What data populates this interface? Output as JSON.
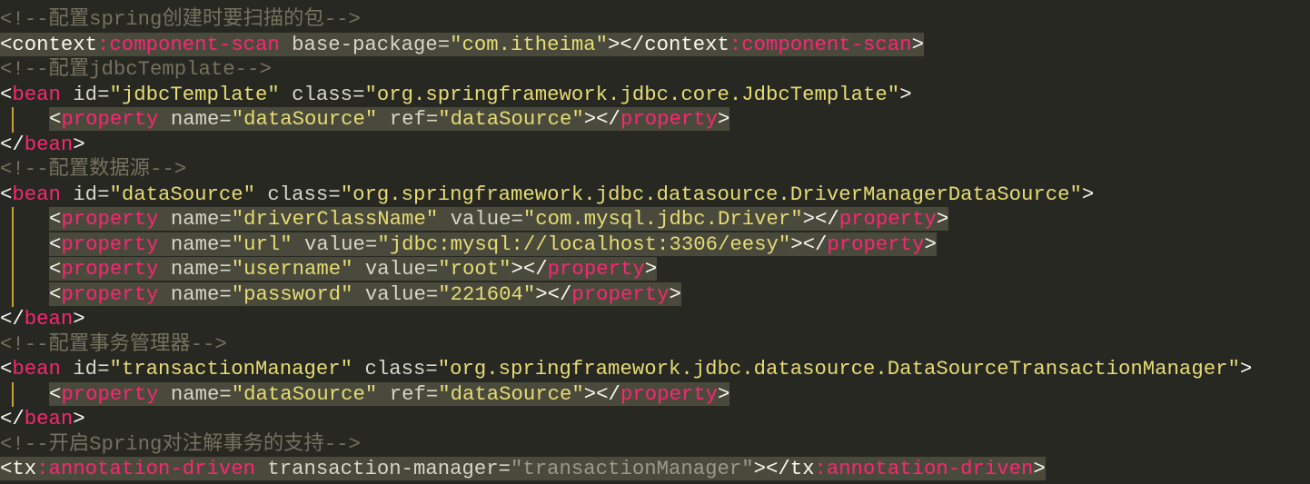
{
  "editor": {
    "colors": {
      "background": "#272822",
      "text": "#f8f8f2",
      "tag": "#f92672",
      "attr": "#d5d5c8",
      "string": "#e6db74",
      "comment": "#75715e",
      "highlight": "#4a4a3c",
      "guide": "#c6a23e"
    },
    "lines": [
      {
        "tokens": [
          {
            "t": "<!--配置spring创建时要扫描的包-->",
            "k": "c"
          }
        ]
      },
      {
        "hl": true,
        "tokens": [
          {
            "t": "<context",
            "k": "t"
          },
          {
            "t": ":component-scan",
            "k": "n"
          },
          {
            "t": " base-package=",
            "k": "a"
          },
          {
            "t": "\"com.itheima\"",
            "k": "s"
          },
          {
            "t": "></context",
            "k": "t"
          },
          {
            "t": ":component-scan",
            "k": "n"
          },
          {
            "t": ">",
            "k": "t"
          }
        ]
      },
      {
        "tokens": [
          {
            "t": "<!--配置jdbcTemplate-->",
            "k": "c"
          }
        ]
      },
      {
        "tokens": [
          {
            "t": "<",
            "k": "t"
          },
          {
            "t": "bean",
            "k": "n"
          },
          {
            "t": " id=",
            "k": "a"
          },
          {
            "t": "\"jdbcTemplate\"",
            "k": "s"
          },
          {
            "t": " class=",
            "k": "a"
          },
          {
            "t": "\"org.springframework.jdbc.core.JdbcTemplate\"",
            "k": "s"
          },
          {
            "t": ">",
            "k": "t"
          }
        ]
      },
      {
        "indent": true,
        "hl": true,
        "tokens": [
          {
            "t": "<",
            "k": "t"
          },
          {
            "t": "property",
            "k": "n"
          },
          {
            "t": " name=",
            "k": "a"
          },
          {
            "t": "\"dataSource\"",
            "k": "s"
          },
          {
            "t": " ref=",
            "k": "a"
          },
          {
            "t": "\"dataSource\"",
            "k": "s"
          },
          {
            "t": "></",
            "k": "t"
          },
          {
            "t": "property",
            "k": "n"
          },
          {
            "t": ">",
            "k": "t"
          }
        ]
      },
      {
        "tokens": [
          {
            "t": "</",
            "k": "t"
          },
          {
            "t": "bean",
            "k": "n"
          },
          {
            "t": ">",
            "k": "t"
          }
        ]
      },
      {
        "tokens": [
          {
            "t": "<!--配置数据源-->",
            "k": "c"
          }
        ]
      },
      {
        "tokens": [
          {
            "t": "<",
            "k": "t"
          },
          {
            "t": "bean",
            "k": "n"
          },
          {
            "t": " id=",
            "k": "a"
          },
          {
            "t": "\"dataSource\"",
            "k": "s"
          },
          {
            "t": " class=",
            "k": "a"
          },
          {
            "t": "\"org.springframework.jdbc.datasource.DriverManagerDataSource\"",
            "k": "s"
          },
          {
            "t": ">",
            "k": "t"
          }
        ]
      },
      {
        "indent": true,
        "hl": true,
        "tokens": [
          {
            "t": "<",
            "k": "t"
          },
          {
            "t": "property",
            "k": "n"
          },
          {
            "t": " name=",
            "k": "a"
          },
          {
            "t": "\"driverClassName\"",
            "k": "s"
          },
          {
            "t": " value=",
            "k": "a"
          },
          {
            "t": "\"com.mysql.jdbc.Driver\"",
            "k": "s"
          },
          {
            "t": "></",
            "k": "t"
          },
          {
            "t": "property",
            "k": "n"
          },
          {
            "t": ">",
            "k": "t"
          }
        ]
      },
      {
        "indent": true,
        "hl": true,
        "tokens": [
          {
            "t": "<",
            "k": "t"
          },
          {
            "t": "property",
            "k": "n"
          },
          {
            "t": " name=",
            "k": "a"
          },
          {
            "t": "\"url\"",
            "k": "s"
          },
          {
            "t": " value=",
            "k": "a"
          },
          {
            "t": "\"jdbc:mysql://localhost:3306/eesy\"",
            "k": "s"
          },
          {
            "t": "></",
            "k": "t"
          },
          {
            "t": "property",
            "k": "n"
          },
          {
            "t": ">",
            "k": "t"
          }
        ]
      },
      {
        "indent": true,
        "hl": true,
        "tokens": [
          {
            "t": "<",
            "k": "t"
          },
          {
            "t": "property",
            "k": "n"
          },
          {
            "t": " name=",
            "k": "a"
          },
          {
            "t": "\"username\"",
            "k": "s"
          },
          {
            "t": " value=",
            "k": "a"
          },
          {
            "t": "\"root\"",
            "k": "s"
          },
          {
            "t": "></",
            "k": "t"
          },
          {
            "t": "property",
            "k": "n"
          },
          {
            "t": ">",
            "k": "t"
          }
        ]
      },
      {
        "indent": true,
        "hl": true,
        "tokens": [
          {
            "t": "<",
            "k": "t"
          },
          {
            "t": "property",
            "k": "n"
          },
          {
            "t": " name=",
            "k": "a"
          },
          {
            "t": "\"password\"",
            "k": "s"
          },
          {
            "t": " value=",
            "k": "a"
          },
          {
            "t": "\"221604\"",
            "k": "s"
          },
          {
            "t": "></",
            "k": "t"
          },
          {
            "t": "property",
            "k": "n"
          },
          {
            "t": ">",
            "k": "t"
          }
        ]
      },
      {
        "tokens": [
          {
            "t": "</",
            "k": "t"
          },
          {
            "t": "bean",
            "k": "n"
          },
          {
            "t": ">",
            "k": "t"
          }
        ]
      },
      {
        "tokens": [
          {
            "t": "<!--配置事务管理器-->",
            "k": "c"
          }
        ]
      },
      {
        "tokens": [
          {
            "t": "<",
            "k": "t"
          },
          {
            "t": "bean",
            "k": "n"
          },
          {
            "t": " id=",
            "k": "a"
          },
          {
            "t": "\"transactionManager\"",
            "k": "s"
          },
          {
            "t": " class=",
            "k": "a"
          },
          {
            "t": "\"org.springframework.jdbc.datasource.DataSourceTransactionManager\"",
            "k": "s"
          },
          {
            "t": ">",
            "k": "t"
          }
        ]
      },
      {
        "indent": true,
        "hl": true,
        "tokens": [
          {
            "t": "<",
            "k": "t"
          },
          {
            "t": "property",
            "k": "n"
          },
          {
            "t": " name=",
            "k": "a"
          },
          {
            "t": "\"dataSource\"",
            "k": "s"
          },
          {
            "t": " ref=",
            "k": "a"
          },
          {
            "t": "\"dataSource\"",
            "k": "s"
          },
          {
            "t": "></",
            "k": "t"
          },
          {
            "t": "property",
            "k": "n"
          },
          {
            "t": ">",
            "k": "t"
          }
        ]
      },
      {
        "tokens": [
          {
            "t": "</",
            "k": "t"
          },
          {
            "t": "bean",
            "k": "n"
          },
          {
            "t": ">",
            "k": "t"
          }
        ]
      },
      {
        "tokens": [
          {
            "t": "<!--开启Spring对注解事务的支持-->",
            "k": "c"
          }
        ]
      },
      {
        "hl": true,
        "tokens": [
          {
            "t": "<tx",
            "k": "t"
          },
          {
            "t": ":annotation-driven",
            "k": "n"
          },
          {
            "t": " transaction-manager=",
            "k": "a"
          },
          {
            "t": "\"transactionManager\"",
            "k": "g"
          },
          {
            "t": "></tx",
            "k": "t"
          },
          {
            "t": ":annotation-driven",
            "k": "n"
          },
          {
            "t": ">",
            "k": "t"
          }
        ]
      }
    ]
  }
}
